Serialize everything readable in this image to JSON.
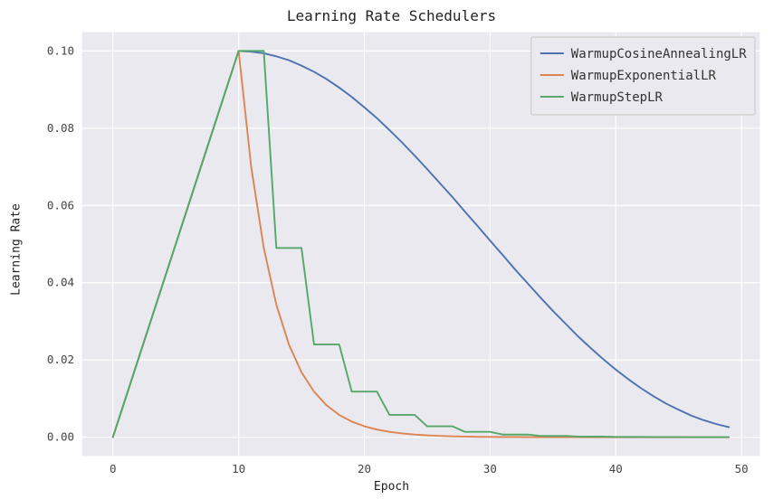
{
  "chart_data": {
    "type": "line",
    "title": "Learning Rate Schedulers",
    "xlabel": "Epoch",
    "ylabel": "Learning Rate",
    "xlim": [
      -2.5,
      51.5
    ],
    "ylim": [
      -0.005,
      0.105
    ],
    "xticks": [
      0,
      10,
      20,
      30,
      40,
      50
    ],
    "yticks": [
      0.0,
      0.02,
      0.04,
      0.06,
      0.08,
      0.1
    ],
    "ytick_labels": [
      "0.00",
      "0.02",
      "0.04",
      "0.06",
      "0.08",
      "0.10"
    ],
    "legend": [
      "WarmupCosineAnnealingLR",
      "WarmupExponentialLR",
      "WarmupStepLR"
    ],
    "colors": {
      "WarmupCosineAnnealingLR": "#4c72b0",
      "WarmupExponentialLR": "#dd8452",
      "WarmupStepLR": "#55a868"
    },
    "x": [
      0,
      1,
      2,
      3,
      4,
      5,
      6,
      7,
      8,
      9,
      10,
      11,
      12,
      13,
      14,
      15,
      16,
      17,
      18,
      19,
      20,
      21,
      22,
      23,
      24,
      25,
      26,
      27,
      28,
      29,
      30,
      31,
      32,
      33,
      34,
      35,
      36,
      37,
      38,
      39,
      40,
      41,
      42,
      43,
      44,
      45,
      46,
      47,
      48,
      49
    ],
    "series": [
      {
        "name": "WarmupCosineAnnealingLR",
        "values": [
          0.0,
          0.01,
          0.02,
          0.03,
          0.04,
          0.05,
          0.06,
          0.07,
          0.08,
          0.09,
          0.1,
          0.0998,
          0.0994,
          0.0986,
          0.0976,
          0.0962,
          0.0946,
          0.0927,
          0.0905,
          0.0881,
          0.0854,
          0.0826,
          0.0795,
          0.0763,
          0.0729,
          0.0694,
          0.0658,
          0.0622,
          0.0584,
          0.0547,
          0.0509,
          0.0472,
          0.0434,
          0.0398,
          0.0362,
          0.0327,
          0.0294,
          0.0261,
          0.0231,
          0.0202,
          0.0175,
          0.015,
          0.0127,
          0.0106,
          0.0087,
          0.0071,
          0.0056,
          0.0044,
          0.0034,
          0.0026
        ]
      },
      {
        "name": "WarmupExponentialLR",
        "values": [
          0.0,
          0.01,
          0.02,
          0.03,
          0.04,
          0.05,
          0.06,
          0.07,
          0.08,
          0.09,
          0.1,
          0.07,
          0.049,
          0.0343,
          0.024,
          0.0168,
          0.0118,
          0.00824,
          0.00576,
          0.00404,
          0.00283,
          0.00198,
          0.00138,
          0.00097,
          0.00068,
          0.00048,
          0.00033,
          0.00023,
          0.00016,
          0.000113,
          7.92e-05,
          5.54e-05,
          3.88e-05,
          2.72e-05,
          1.9e-05,
          1.33e-05,
          9.32e-06,
          6.52e-06,
          4.57e-06,
          3.2e-06,
          2.24e-06,
          1.57e-06,
          1.1e-06,
          7.67e-07,
          5.37e-07,
          3.76e-07,
          2.63e-07,
          1.84e-07,
          1.29e-07,
          9.03e-08
        ]
      },
      {
        "name": "WarmupStepLR",
        "values": [
          0.0,
          0.01,
          0.02,
          0.03,
          0.04,
          0.05,
          0.06,
          0.07,
          0.08,
          0.09,
          0.1,
          0.1,
          0.1,
          0.049,
          0.049,
          0.049,
          0.024,
          0.024,
          0.024,
          0.0118,
          0.0118,
          0.0118,
          0.00577,
          0.00577,
          0.00577,
          0.00283,
          0.00283,
          0.00283,
          0.00139,
          0.00139,
          0.00139,
          0.000679,
          0.000679,
          0.000679,
          0.000333,
          0.000333,
          0.000333,
          0.000163,
          0.000163,
          0.000163,
          7.99e-05,
          7.99e-05,
          7.99e-05,
          3.92e-05,
          3.92e-05,
          3.92e-05,
          1.92e-05,
          1.92e-05,
          1.92e-05,
          9.41e-06
        ]
      }
    ]
  }
}
